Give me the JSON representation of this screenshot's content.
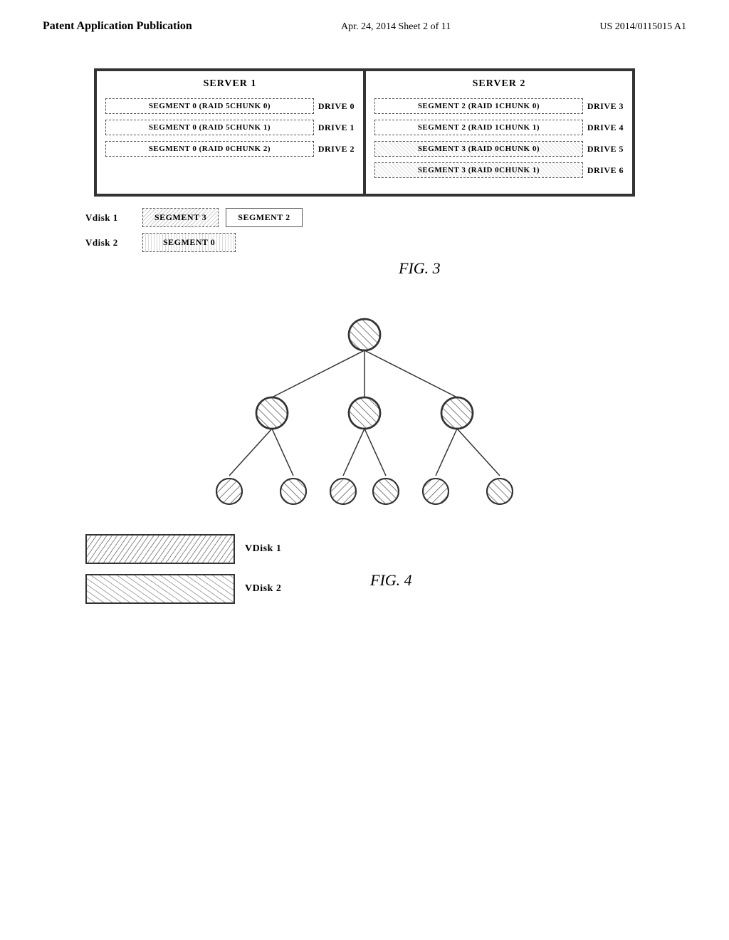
{
  "header": {
    "left": "Patent Application Publication",
    "center": "Apr. 24, 2014  Sheet 2 of 11",
    "right": "US 2014/0115015 A1"
  },
  "fig3": {
    "server1": {
      "title": "SERVER 1",
      "drives": [
        {
          "segment": "SEGMENT 0 (RAID 5 CHUNK 0)",
          "drive": "DRIVE 0",
          "style": "dashed"
        },
        {
          "segment": "SEGMENT 0 (RAID 5 CHUNK 1)",
          "drive": "DRIVE 1",
          "style": "dashed"
        },
        {
          "segment": "SEGMENT 0 (RAID 0 CHUNK 2)",
          "drive": "DRIVE 2",
          "style": "dashed"
        }
      ]
    },
    "server2": {
      "title": "SERVER 2",
      "drives": [
        {
          "segment": "SEGMENT 2 (RAID 1 CHUNK 0)",
          "drive": "DRIVE 3",
          "style": "plain"
        },
        {
          "segment": "SEGMENT 2 (RAID 1 CHUNK 1)",
          "drive": "DRIVE 4",
          "style": "plain"
        },
        {
          "segment": "SEGMENT 3 (RAID 0 CHUNK 0)",
          "drive": "DRIVE 5",
          "style": "hatched"
        },
        {
          "segment": "SEGMENT 3 (RAID 0 CHUNK 1)",
          "drive": "DRIVE 6",
          "style": "hatched"
        }
      ]
    },
    "vdisks": [
      {
        "label": "Vdisk 1",
        "segments": [
          {
            "text": "SEGMENT 3",
            "style": "hatched"
          },
          {
            "text": "SEGMENT 2",
            "style": "plain"
          }
        ]
      },
      {
        "label": "Vdisk 2",
        "segments": [
          {
            "text": "SEGMENT 0",
            "style": "dotted"
          }
        ]
      }
    ],
    "fig_label": "FIG. 3"
  },
  "fig4": {
    "legend": [
      {
        "label": "VDisk 1",
        "style": "vdisk1"
      },
      {
        "label": "VDisk 2",
        "style": "vdisk2"
      }
    ],
    "fig_label": "FIG. 4"
  }
}
